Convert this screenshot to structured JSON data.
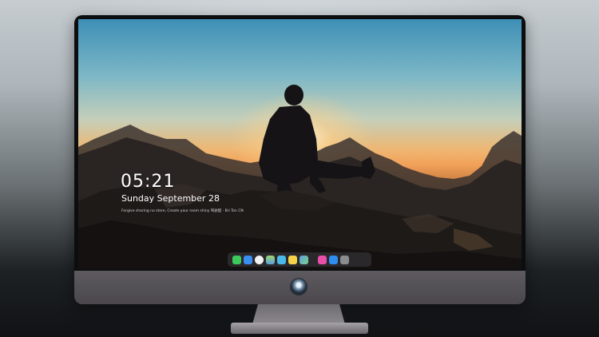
{
  "lockscreen": {
    "time": "05:21",
    "date": "Sunday September  28",
    "quote": "Forgive sharing no store, Create your room shiny 驾驶艇 · Bri Ton CN"
  },
  "dock": {
    "apps": [
      {
        "name": "messages-icon",
        "color": "#3cc85a"
      },
      {
        "name": "mail-icon",
        "color": "#3a8ef0"
      },
      {
        "name": "safari-icon",
        "color": "#f2f2f2"
      },
      {
        "name": "files-icon",
        "color": "#7fbf5a"
      },
      {
        "name": "video-icon",
        "color": "#4cb8e8"
      },
      {
        "name": "notes-icon",
        "color": "#f4d24a"
      },
      {
        "name": "photos-icon",
        "color": "#5aa0e0"
      },
      {
        "name": "itunes-icon",
        "color": "#e84fa8"
      },
      {
        "name": "appstore-icon",
        "color": "#2f8cf0"
      },
      {
        "name": "camera-icon",
        "color": "#8a8c90"
      }
    ]
  }
}
